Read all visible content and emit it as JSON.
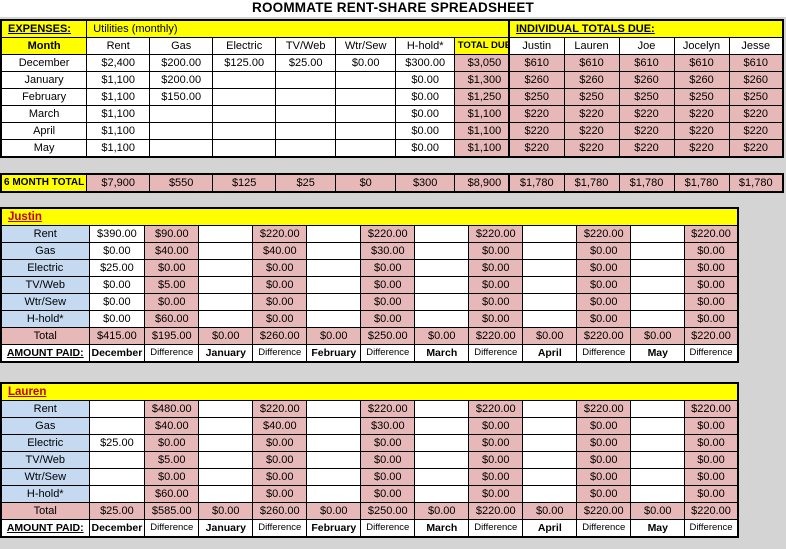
{
  "document": {
    "title": "ROOMMATE RENT-SHARE SPREADSHEET"
  },
  "expenses": {
    "section_label": "EXPENSES:",
    "section_note": "Utilities (monthly)",
    "headers": [
      "Month",
      "Rent",
      "Gas",
      "Electric",
      "TV/Web",
      "Wtr/Sew",
      "H-hold*",
      "TOTAL DUE"
    ],
    "rows": [
      {
        "month": "December",
        "rent": "$2,400",
        "gas": "$200.00",
        "electric": "$125.00",
        "tvweb": "$25.00",
        "wtrsew": "$0.00",
        "hhold": "$300.00",
        "total": "$3,050"
      },
      {
        "month": "January",
        "rent": "$1,100",
        "gas": "$200.00",
        "electric": "",
        "tvweb": "",
        "wtrsew": "",
        "hhold": "$0.00",
        "total": "$1,300"
      },
      {
        "month": "February",
        "rent": "$1,100",
        "gas": "$150.00",
        "electric": "",
        "tvweb": "",
        "wtrsew": "",
        "hhold": "$0.00",
        "total": "$1,250"
      },
      {
        "month": "March",
        "rent": "$1,100",
        "gas": "",
        "electric": "",
        "tvweb": "",
        "wtrsew": "",
        "hhold": "$0.00",
        "total": "$1,100"
      },
      {
        "month": "April",
        "rent": "$1,100",
        "gas": "",
        "electric": "",
        "tvweb": "",
        "wtrsew": "",
        "hhold": "$0.00",
        "total": "$1,100"
      },
      {
        "month": "May",
        "rent": "$1,100",
        "gas": "",
        "electric": "",
        "tvweb": "",
        "wtrsew": "",
        "hhold": "$0.00",
        "total": "$1,100"
      }
    ],
    "total_row": {
      "label": "6 MONTH TOTAL",
      "rent": "$7,900",
      "gas": "$550",
      "electric": "$125",
      "tvweb": "$25",
      "wtrsew": "$0",
      "hhold": "$300",
      "total": "$8,900"
    }
  },
  "individual_totals": {
    "section_label": "INDIVIDUAL TOTALS DUE:",
    "headers": [
      "Justin",
      "Lauren",
      "Joe",
      "Jocelyn",
      "Jesse"
    ],
    "rows": [
      [
        "$610",
        "$610",
        "$610",
        "$610",
        "$610"
      ],
      [
        "$260",
        "$260",
        "$260",
        "$260",
        "$260"
      ],
      [
        "$250",
        "$250",
        "$250",
        "$250",
        "$250"
      ],
      [
        "$220",
        "$220",
        "$220",
        "$220",
        "$220"
      ],
      [
        "$220",
        "$220",
        "$220",
        "$220",
        "$220"
      ],
      [
        "$220",
        "$220",
        "$220",
        "$220",
        "$220"
      ]
    ],
    "total_row": [
      "$1,780",
      "$1,780",
      "$1,780",
      "$1,780",
      "$1,780"
    ]
  },
  "people": [
    {
      "name": "Justin",
      "row_labels": [
        "Rent",
        "Gas",
        "Electric",
        "TV/Web",
        "Wtr/Sew",
        "H-hold*"
      ],
      "total_label": "Total",
      "amount_paid_label": "AMOUNT PAID:",
      "column_headers": [
        "December",
        "Difference",
        "January",
        "Difference",
        "February",
        "Difference",
        "March",
        "Difference",
        "April",
        "Difference",
        "May",
        "Difference"
      ],
      "grid": [
        [
          "$390.00",
          "$90.00",
          "",
          "$220.00",
          "",
          "$220.00",
          "",
          "$220.00",
          "",
          "$220.00",
          "",
          "$220.00"
        ],
        [
          "$0.00",
          "$40.00",
          "",
          "$40.00",
          "",
          "$30.00",
          "",
          "$0.00",
          "",
          "$0.00",
          "",
          "$0.00"
        ],
        [
          "$25.00",
          "$0.00",
          "",
          "$0.00",
          "",
          "$0.00",
          "",
          "$0.00",
          "",
          "$0.00",
          "",
          "$0.00"
        ],
        [
          "$0.00",
          "$5.00",
          "",
          "$0.00",
          "",
          "$0.00",
          "",
          "$0.00",
          "",
          "$0.00",
          "",
          "$0.00"
        ],
        [
          "$0.00",
          "$0.00",
          "",
          "$0.00",
          "",
          "$0.00",
          "",
          "$0.00",
          "",
          "$0.00",
          "",
          "$0.00"
        ],
        [
          "$0.00",
          "$60.00",
          "",
          "$0.00",
          "",
          "$0.00",
          "",
          "$0.00",
          "",
          "$0.00",
          "",
          "$0.00"
        ]
      ],
      "totals": [
        "$415.00",
        "$195.00",
        "$0.00",
        "$260.00",
        "$0.00",
        "$250.00",
        "$0.00",
        "$220.00",
        "$0.00",
        "$220.00",
        "$0.00",
        "$220.00"
      ]
    },
    {
      "name": "Lauren",
      "row_labels": [
        "Rent",
        "Gas",
        "Electric",
        "TV/Web",
        "Wtr/Sew",
        "H-hold*"
      ],
      "total_label": "Total",
      "amount_paid_label": "AMOUNT PAID:",
      "column_headers": [
        "December",
        "Difference",
        "January",
        "Difference",
        "February",
        "Difference",
        "March",
        "Difference",
        "April",
        "Difference",
        "May",
        "Difference"
      ],
      "grid": [
        [
          "",
          "$480.00",
          "",
          "$220.00",
          "",
          "$220.00",
          "",
          "$220.00",
          "",
          "$220.00",
          "",
          "$220.00"
        ],
        [
          "",
          "$40.00",
          "",
          "$40.00",
          "",
          "$30.00",
          "",
          "$0.00",
          "",
          "$0.00",
          "",
          "$0.00"
        ],
        [
          "$25.00",
          "$0.00",
          "",
          "$0.00",
          "",
          "$0.00",
          "",
          "$0.00",
          "",
          "$0.00",
          "",
          "$0.00"
        ],
        [
          "",
          "$5.00",
          "",
          "$0.00",
          "",
          "$0.00",
          "",
          "$0.00",
          "",
          "$0.00",
          "",
          "$0.00"
        ],
        [
          "",
          "$0.00",
          "",
          "$0.00",
          "",
          "$0.00",
          "",
          "$0.00",
          "",
          "$0.00",
          "",
          "$0.00"
        ],
        [
          "",
          "$60.00",
          "",
          "$0.00",
          "",
          "$0.00",
          "",
          "$0.00",
          "",
          "$0.00",
          "",
          "$0.00"
        ]
      ],
      "totals": [
        "$25.00",
        "$585.00",
        "$0.00",
        "$260.00",
        "$0.00",
        "$250.00",
        "$0.00",
        "$220.00",
        "$0.00",
        "$220.00",
        "$0.00",
        "$220.00"
      ]
    }
  ],
  "colors": {
    "highlight": "#ffff00",
    "value_fill": "#e6b8b7",
    "label_fill": "#c5d9f1",
    "sheet_bg": "#d4d4d4",
    "accent_text": "#c00000"
  }
}
